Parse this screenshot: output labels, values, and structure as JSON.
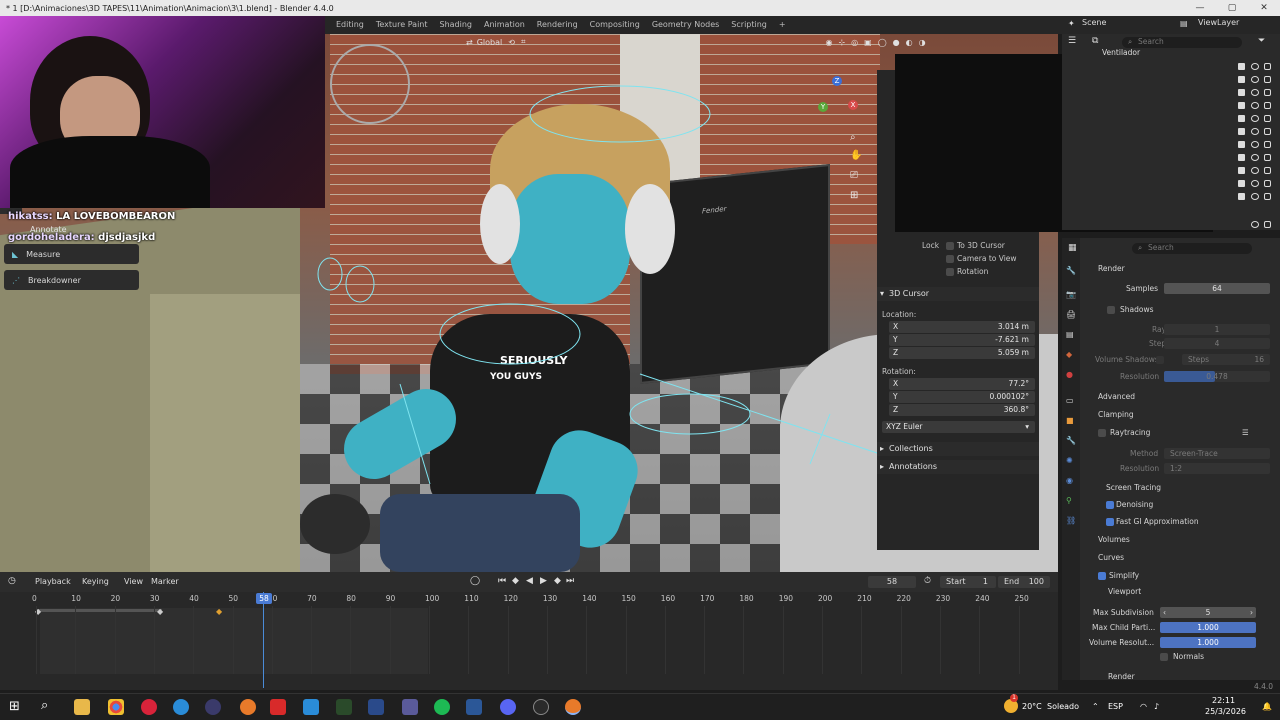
{
  "window": {
    "title": "* 1 [D:\\Animaciones\\3D TAPES\\11\\Animation\\Animacion\\3\\1.blend] - Blender 4.4.0"
  },
  "workspaces": [
    "Editing",
    "Texture Paint",
    "Shading",
    "Animation",
    "Rendering",
    "Compositing",
    "Geometry Nodes",
    "Scripting"
  ],
  "header_right": {
    "scene": "Scene",
    "view_layer": "ViewLayer"
  },
  "viewport": {
    "orientation": "Global",
    "shirt_text_1": "SERIOUSLY",
    "shirt_text_2": "YOU GUYS",
    "amp_brand": "Fender"
  },
  "chat": [
    {
      "user": "hikatss:",
      "message": "LA LOVEBOMBEARON"
    },
    {
      "user": "gordoheladera:",
      "message": "djsdjasjkd"
    }
  ],
  "tools": [
    "Annotate",
    "Measure",
    "Breakdowner"
  ],
  "npanel": {
    "lock_label": "Lock",
    "lock_options": [
      "To 3D Cursor",
      "Camera to View",
      "Rotation"
    ],
    "cursor_section": "3D Cursor",
    "location_label": "Location:",
    "location": [
      {
        "axis": "X",
        "value": "3.014 m"
      },
      {
        "axis": "Y",
        "value": "-7.621 m"
      },
      {
        "axis": "Z",
        "value": "5.059 m"
      }
    ],
    "rotation_label": "Rotation:",
    "rotation": [
      {
        "axis": "X",
        "value": "77.2°"
      },
      {
        "axis": "Y",
        "value": "0.000102°"
      },
      {
        "axis": "Z",
        "value": "360.8°"
      }
    ],
    "rotation_mode": "XYZ Euler",
    "collections": "Collections",
    "annotations": "Annotations"
  },
  "outliner": {
    "search_placeholder": "Search",
    "first_item": "Ventilador"
  },
  "properties": {
    "search_placeholder": "Search",
    "render_section": "Render",
    "samples_label": "Samples",
    "samples_value": "64",
    "shadows": "Shadows",
    "rays_label": "Rays",
    "rays_value": "1",
    "steps_label": "Steps",
    "steps_value": "4",
    "volume_shadows": "Volume Shadows",
    "vs_steps_label": "Steps",
    "vs_steps_value": "16",
    "resolution_label": "Resolution",
    "resolution_value": "0.478",
    "advanced": "Advanced",
    "clamping": "Clamping",
    "raytracing": "Raytracing",
    "method_label": "Method",
    "method_value": "Screen-Trace",
    "rt_resolution_label": "Resolution",
    "rt_resolution_value": "1:2",
    "screen_tracing": "Screen Tracing",
    "denoising": "Denoising",
    "fast_gi": "Fast GI Approximation",
    "volumes": "Volumes",
    "curves": "Curves",
    "simplify": "Simplify",
    "viewport": "Viewport",
    "max_subdiv_label": "Max Subdivision",
    "max_subdiv_value": "5",
    "max_child_label": "Max Child Parti...",
    "max_child_value": "1.000",
    "vol_res_label": "Volume Resolut...",
    "vol_res_value": "1.000",
    "normals": "Normals",
    "render_sub": "Render",
    "version": "4.4.0"
  },
  "timeline": {
    "menus": [
      "Playback",
      "Keying",
      "View",
      "Marker"
    ],
    "current_frame": "58",
    "start_label": "Start",
    "start_value": "1",
    "end_label": "End",
    "end_value": "100",
    "ticks": [
      "0",
      "10",
      "20",
      "30",
      "40",
      "50",
      "60",
      "70",
      "80",
      "90",
      "100",
      "110",
      "120",
      "130",
      "140",
      "150",
      "160",
      "170",
      "180",
      "190",
      "200",
      "210",
      "220",
      "230",
      "240",
      "250"
    ],
    "playhead_label": "58"
  },
  "taskbar": {
    "weather_temp": "20°C",
    "weather_desc": "Soleado",
    "lang": "ESP",
    "time": "22:11",
    "date": "25/3/2026",
    "weather_badge": "1"
  },
  "colors": {
    "accent": "#4a7bd4",
    "wire": "#7fe4f0",
    "skin": "#3fb1c4"
  }
}
